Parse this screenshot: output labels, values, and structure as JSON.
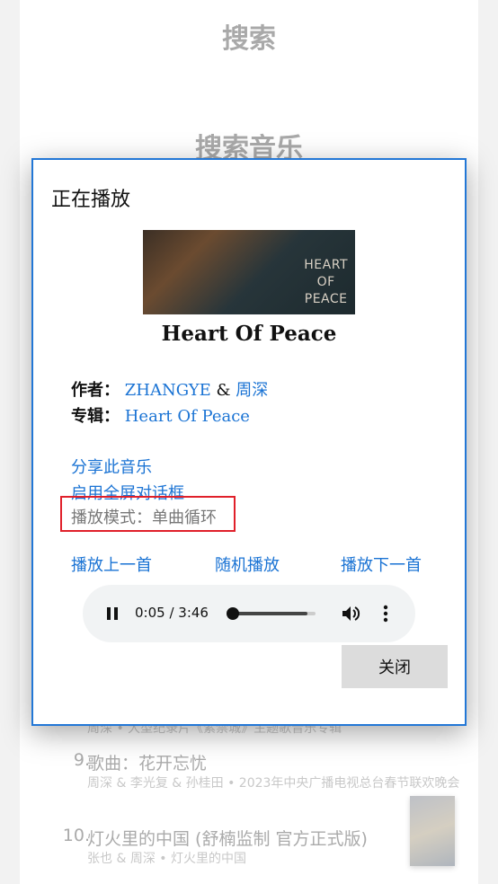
{
  "background": {
    "header_title": "搜索",
    "section_title": "搜索音乐",
    "list": [
      {
        "subtitle": "周深 • 大型纪录片《紫禁城》主题歌音乐专辑"
      },
      {
        "index": "9.",
        "title": "歌曲：花开忘忧",
        "subtitle": "周深 & 李光复 & 孙桂田 • 2023年中央广播电视总台春节联欢晚会"
      },
      {
        "index": "10.",
        "title": "灯火里的中国 (舒楠监制 官方正式版)",
        "subtitle": "张也 & 周深 • 灯火里的中国"
      }
    ]
  },
  "dialog": {
    "title": "正在播放",
    "cover_text": "HEART OF PEACE",
    "song_title": "Heart Of Peace",
    "author_label": "作者：",
    "author_1": "ZHANGYE",
    "author_sep": " & ",
    "author_2": "周深",
    "album_label": "专辑：",
    "album": "Heart Of Peace",
    "share_link": "分享此音乐",
    "fullscreen_link": "启用全屏对话框",
    "play_mode": "播放模式：单曲循环",
    "prev": "播放上一首",
    "shuffle": "随机播放",
    "next": "播放下一首",
    "player": {
      "time": "0:05 / 3:46",
      "progress_percent": 2,
      "buffered_percent": 90,
      "state": "playing"
    },
    "close": "关闭"
  },
  "colors": {
    "accent": "#1a73d4",
    "highlight_box": "#e0202a"
  }
}
